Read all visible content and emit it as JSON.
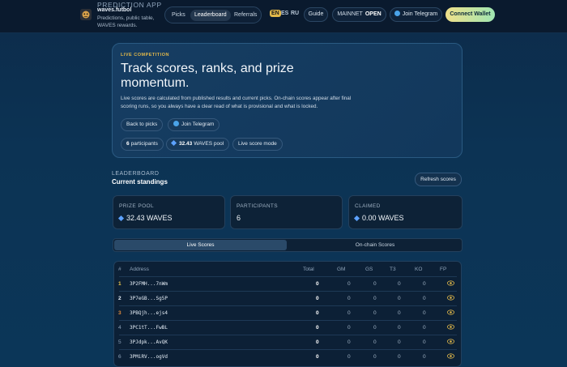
{
  "header": {
    "brand_pre": "PREDICTION APP",
    "brand_name": "waves.futbol",
    "brand_desc": "Predictions, public table, WAVES rewards.",
    "nav": [
      {
        "label": "Picks",
        "active": false
      },
      {
        "label": "Leaderboard",
        "active": true
      },
      {
        "label": "Referrals",
        "active": false
      }
    ],
    "languages": [
      "EN",
      "ES",
      "RU"
    ],
    "active_language": "EN",
    "guide_label": "Guide",
    "network_label": "MAINNET",
    "network_status": "OPEN",
    "telegram_label": "Join Telegram",
    "wallet_label": "Connect Wallet"
  },
  "hero": {
    "eyebrow": "LIVE COMPETITION",
    "title": "Track scores, ranks, and prize momentum.",
    "description": "Live scores are calculated from published results and current picks. On-chain scores appear after final scoring runs, so you always have a clear read of what is provisional and what is locked.",
    "back_label": "Back to picks",
    "telegram_label": "Join Telegram",
    "participants_count": "6",
    "participants_label": "participants",
    "pool_value": "32.43",
    "pool_label": "WAVES pool",
    "mode_label": "Live score mode"
  },
  "leaderboard": {
    "eyebrow": "LEADERBOARD",
    "title": "Current standings",
    "refresh_label": "Refresh scores",
    "stats": [
      {
        "label": "PRIZE POOL",
        "value": "32.43 WAVES",
        "icon": "diamond-icon"
      },
      {
        "label": "PARTICIPANTS",
        "value": "6",
        "icon": ""
      },
      {
        "label": "CLAIMED",
        "value": "0.00 WAVES",
        "icon": "diamond-icon"
      }
    ],
    "tabs": [
      {
        "label": "Live Scores",
        "active": true
      },
      {
        "label": "On-chain Scores",
        "active": false
      }
    ],
    "columns": [
      "#",
      "Address",
      "Total",
      "GM",
      "GS",
      "T3",
      "KO",
      "FP"
    ],
    "rows": [
      {
        "rank": "1",
        "address": "3P2FMH...7nWm",
        "total": "0",
        "gm": "0",
        "gs": "0",
        "t3": "0",
        "ko": "0"
      },
      {
        "rank": "2",
        "address": "3P7eGB...Sg5P",
        "total": "0",
        "gm": "0",
        "gs": "0",
        "t3": "0",
        "ko": "0"
      },
      {
        "rank": "3",
        "address": "3PBQjh...ejs4",
        "total": "0",
        "gm": "0",
        "gs": "0",
        "t3": "0",
        "ko": "0"
      },
      {
        "rank": "4",
        "address": "3PC1tT...FwBL",
        "total": "0",
        "gm": "0",
        "gs": "0",
        "t3": "0",
        "ko": "0"
      },
      {
        "rank": "5",
        "address": "3PJdpk...AvQK",
        "total": "0",
        "gm": "0",
        "gs": "0",
        "t3": "0",
        "ko": "0"
      },
      {
        "rank": "6",
        "address": "3PMiRV...ogVd",
        "total": "0",
        "gm": "0",
        "gs": "0",
        "t3": "0",
        "ko": "0"
      }
    ],
    "rank_colors": [
      "#f0c94a",
      "#e6eef7",
      "#e08a3c",
      "#8ea3ba",
      "#8ea3ba",
      "#8ea3ba"
    ]
  }
}
